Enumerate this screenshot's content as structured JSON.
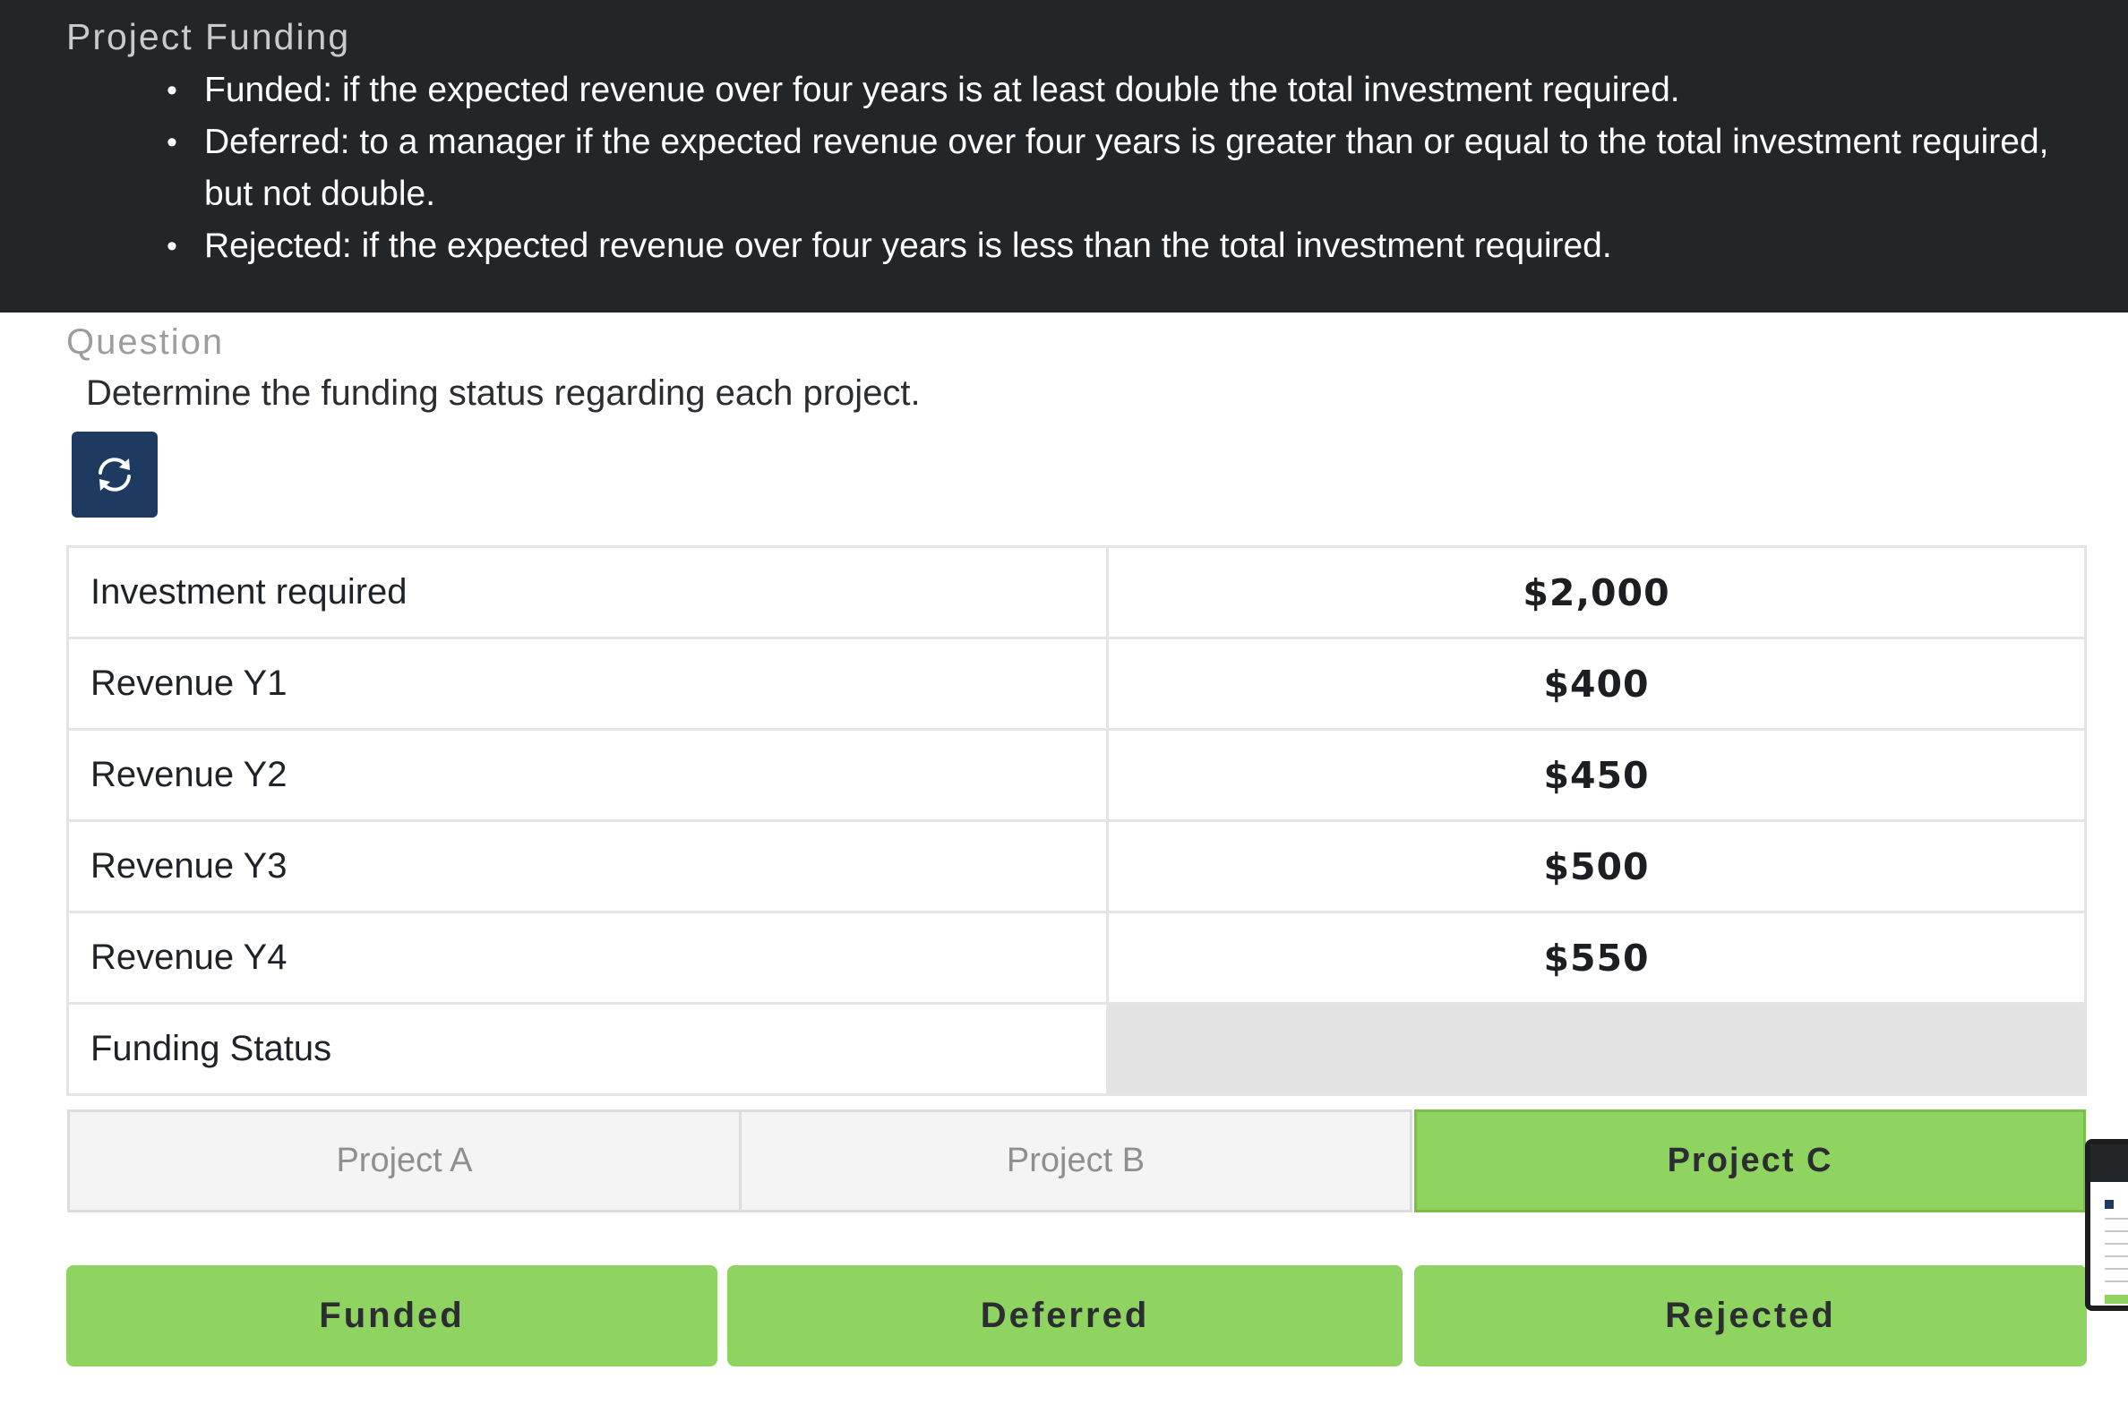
{
  "header": {
    "title": "Project Funding",
    "rules": [
      "Funded: if the expected revenue over four years is at least double the total investment required.",
      "Deferred: to a manager if the expected revenue over four years is greater than or equal to the total investment required, but not double.",
      "Rejected: if the expected revenue over four years is less than the total investment required."
    ]
  },
  "question": {
    "label": "Question",
    "prompt": "Determine the funding status regarding each project.",
    "reset_icon": "refresh-icon",
    "reset_color": "#1e3a60"
  },
  "table": {
    "rows": [
      {
        "label": "Investment required",
        "value": "$2,000"
      },
      {
        "label": "Revenue Y1",
        "value": "$400"
      },
      {
        "label": "Revenue Y2",
        "value": "$450"
      },
      {
        "label": "Revenue Y3",
        "value": "$500"
      },
      {
        "label": "Revenue Y4",
        "value": "$550"
      },
      {
        "label": "Funding Status",
        "value": ""
      }
    ]
  },
  "tabs": [
    {
      "label": "Project A",
      "active": false
    },
    {
      "label": "Project B",
      "active": false
    },
    {
      "label": "Project C",
      "active": true
    }
  ],
  "answers": [
    "Funded",
    "Deferred",
    "Rejected"
  ],
  "colors": {
    "header_bg": "#232629",
    "accent_green": "#8fd460",
    "button_blue": "#1e3a60"
  }
}
